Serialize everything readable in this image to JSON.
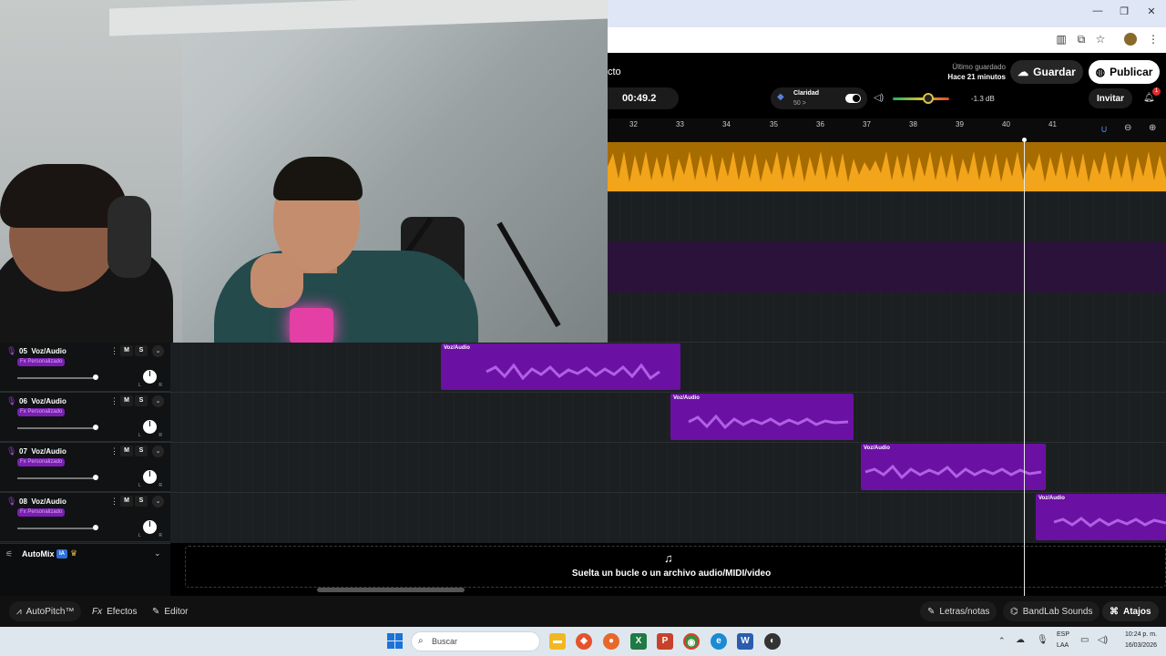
{
  "header": {
    "project_partial": "cto",
    "last_saved_label": "Último guardado",
    "last_saved_time": "Hace 21 minutos",
    "save_label": "Guardar",
    "publish_label": "Publicar",
    "time": "00:49.2",
    "clarity_label": "Claridad",
    "clarity_value": "50 >",
    "volume_db": "-1.3 dB",
    "invite_label": "Invitar",
    "notif_count": "1"
  },
  "ruler": {
    "ticks": [
      "32",
      "33",
      "34",
      "35",
      "36",
      "37",
      "38",
      "39",
      "40",
      "41"
    ]
  },
  "tracks": [
    {
      "number": "05",
      "name": "Voz/Audio",
      "fx": "Fx Personalizado",
      "mute": "M",
      "solo": "S",
      "pan_l": "L",
      "pan_r": "R",
      "clip_label": "Voz/Audio"
    },
    {
      "number": "06",
      "name": "Voz/Audio",
      "fx": "Fx Personalizado",
      "mute": "M",
      "solo": "S",
      "pan_l": "L",
      "pan_r": "R",
      "clip_label": "Voz/Audio"
    },
    {
      "number": "07",
      "name": "Voz/Audio",
      "fx": "Fx Personalizado",
      "mute": "M",
      "solo": "S",
      "pan_l": "L",
      "pan_r": "R",
      "clip_label": "Voz/Audio"
    },
    {
      "number": "08",
      "name": "Voz/Audio",
      "fx": "Fx Personalizado",
      "mute": "M",
      "solo": "S",
      "pan_l": "L",
      "pan_r": "R",
      "clip_label": "Voz/Audio"
    }
  ],
  "automix": {
    "label": "AutoMix",
    "badge": "IA"
  },
  "dropzone": {
    "text": "Suelta un bucle o un archivo audio/MIDI/video"
  },
  "toolbar": {
    "autopitch": "AutoPitch™",
    "effects": "Efectos",
    "editor": "Editor",
    "lyrics": "Letras/notas",
    "sounds": "BandLab Sounds",
    "shortcuts": "Atajos"
  },
  "taskbar": {
    "search_placeholder": "Buscar",
    "lang": "ESP",
    "lang2": "LAA",
    "time": "10:24 p. m.",
    "date": "16/03/2026"
  },
  "colors": {
    "clip": "#6a11a3",
    "master": "#f5a81c",
    "accent": "#9c3fd1"
  }
}
